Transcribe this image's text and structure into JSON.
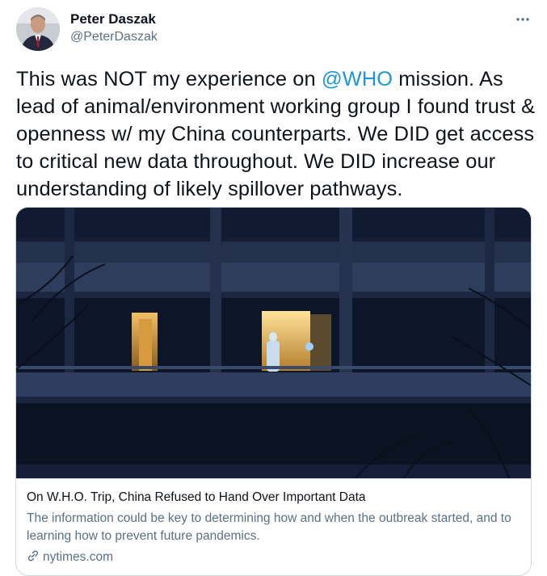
{
  "author": {
    "name": "Peter Daszak",
    "handle": "@PeterDaszak"
  },
  "tweet": {
    "text_before_mention": "This was NOT my experience on ",
    "mention": "@WHO",
    "text_after_mention": " mission. As lead of animal/environment working group I found trust & openness w/ my China counterparts. We DID get access to critical new data throughout. We DID increase our understanding of likely spillover pathways."
  },
  "card": {
    "title": "On W.H.O. Trip, China Refused to Hand Over Important Data",
    "description": "The information could be key to determining how and when the outbreak started, and to learning how to prevent future pandemics.",
    "domain": "nytimes.com"
  },
  "icons": {
    "more": "more-horizontal-icon",
    "link": "link-icon"
  },
  "colors": {
    "mention": "#1b95e0",
    "secondary_text": "#5b7083",
    "border": "#cfd9de"
  }
}
